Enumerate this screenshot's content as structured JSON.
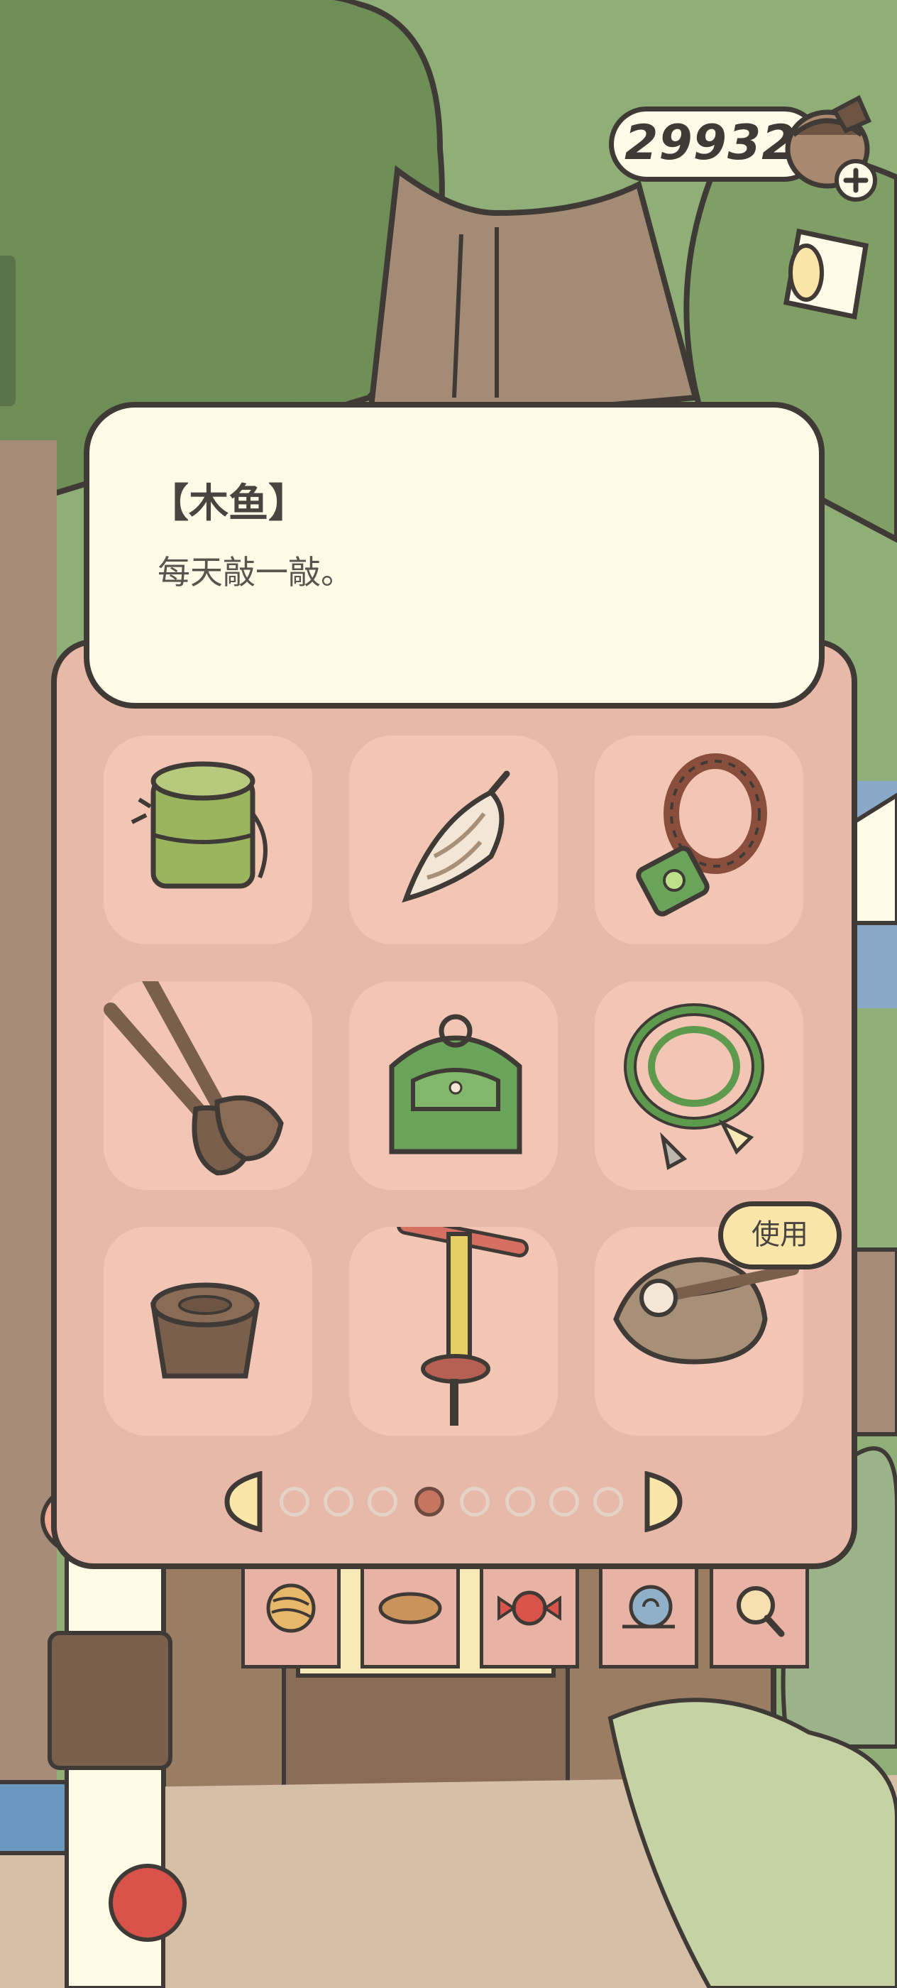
{
  "currency": {
    "clovers": "299328",
    "icon": "acorn-clover-icon",
    "add_icon": "plus-icon"
  },
  "actions": {
    "tickets_icon": "ticket-stub-icon"
  },
  "item_detail": {
    "title": "【木鱼】",
    "description": "每天敲一敲。"
  },
  "bag": {
    "slots": [
      {
        "icon": "bamboo-lunchbox-icon"
      },
      {
        "icon": "conch-shell-icon"
      },
      {
        "icon": "prayer-beads-charm-icon"
      },
      {
        "icon": "wooden-oars-icon"
      },
      {
        "icon": "green-backpack-icon"
      },
      {
        "icon": "climbing-rope-icon"
      },
      {
        "icon": "wooden-tub-icon"
      },
      {
        "icon": "pogo-stick-icon"
      },
      {
        "icon": "wooden-fish-icon"
      }
    ],
    "use_button": "使用",
    "pagination": {
      "pages": 8,
      "current": 4,
      "prev_icon": "arrow-left-icon",
      "next_icon": "arrow-right-icon"
    }
  },
  "shop_tabs": [
    {
      "icon": "yarn-ball-icon"
    },
    {
      "icon": "leaf-plate-icon"
    },
    {
      "icon": "candy-icon"
    },
    {
      "icon": "snail-shell-icon"
    },
    {
      "icon": "magnifier-icon"
    }
  ],
  "colors": {
    "panel": "#e8b9a8",
    "slot": "#f2c5b5",
    "bubble": "#fffbe6",
    "outline": "#3f3a36",
    "accent_dot": "#c67560"
  }
}
